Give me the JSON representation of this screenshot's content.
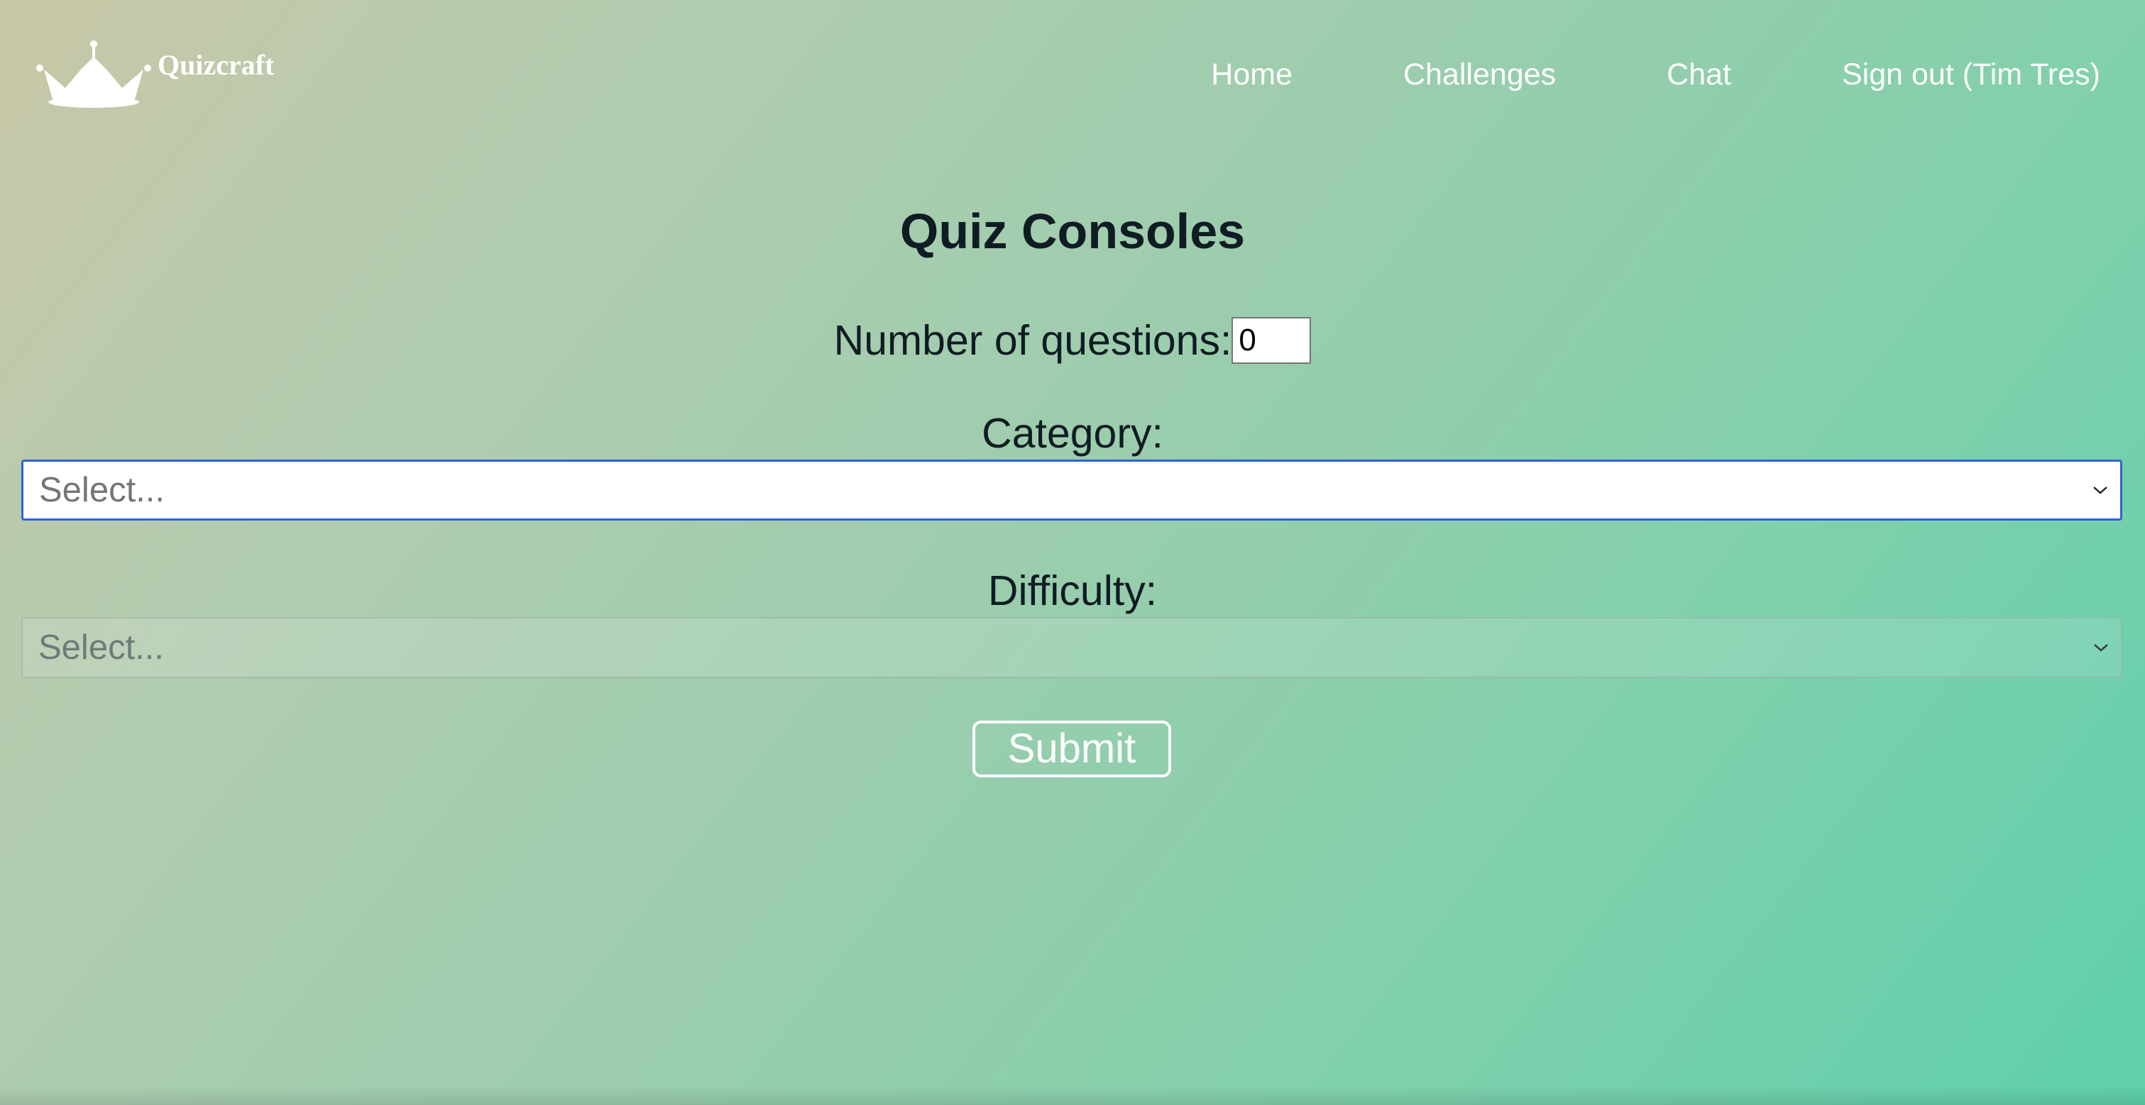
{
  "brand": {
    "name": "Quizcraft",
    "logo_icon": "crown-icon"
  },
  "nav": {
    "home": "Home",
    "challenges": "Challenges",
    "chat": "Chat",
    "sign_out": "Sign out (Tim Tres)"
  },
  "form": {
    "title": "Quiz Consoles",
    "num_questions_label": "Number of questions:",
    "num_questions_value": "0",
    "category_label": "Category:",
    "category_placeholder": "Select...",
    "difficulty_label": "Difficulty:",
    "difficulty_placeholder": "Select...",
    "submit_label": "Submit"
  },
  "colors": {
    "gradient_start": "#c9c7a6",
    "gradient_end": "#5fcfab",
    "text": "#0f1c24",
    "focus_border": "#2e62d6"
  }
}
